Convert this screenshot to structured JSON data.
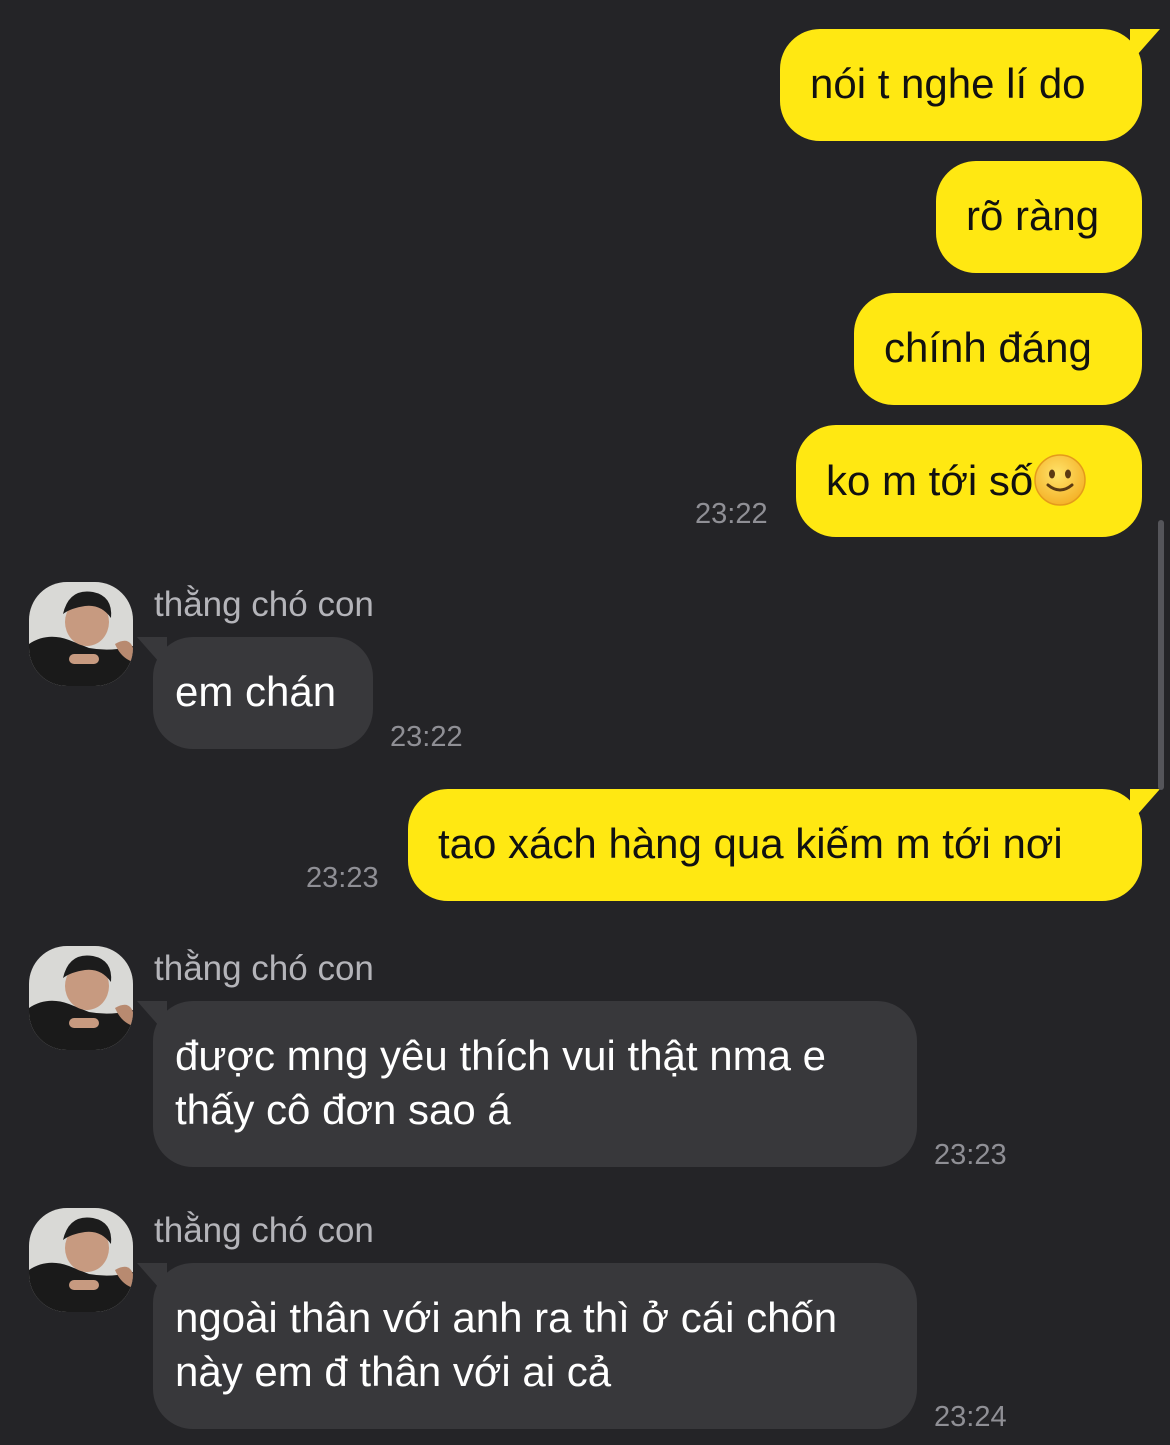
{
  "contact": {
    "name": "thằng chó con"
  },
  "messages": {
    "m1": {
      "text": "nói t nghe lí do"
    },
    "m2": {
      "text": "rõ ràng"
    },
    "m3": {
      "text": "chính đáng"
    },
    "m4": {
      "text": "ko m tới số",
      "emoji": "slightly-smiling-face-emoji",
      "time": "23:22"
    },
    "m5": {
      "text": "em chán",
      "time": "23:22"
    },
    "m6": {
      "text": "tao xách hàng qua kiếm m tới nơi",
      "time": "23:23"
    },
    "m7": {
      "text": "được mng yêu thích vui thật nma e thấy cô đơn sao á",
      "time": "23:23"
    },
    "m8": {
      "text": "ngoài thân với anh ra thì ở cái chốn này em đ thân với ai cả",
      "time": "23:24"
    }
  },
  "colors": {
    "background": "#242427",
    "outgoing_bubble": "#ffe812",
    "incoming_bubble": "#38383b",
    "timestamp": "#8f8f95",
    "sender_name": "#b4b4b9"
  }
}
